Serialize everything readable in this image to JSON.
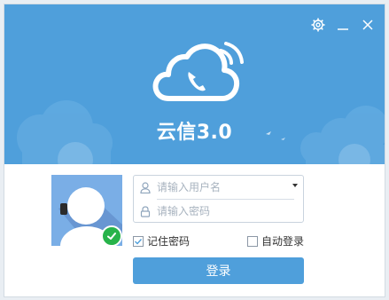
{
  "app": {
    "title": "云信3.0"
  },
  "controls": {
    "settings_icon": "gear-icon",
    "minimize_icon": "minimize-icon",
    "close_icon": "close-icon"
  },
  "form": {
    "username_placeholder": "请输入用户名",
    "password_placeholder": "请输入密码",
    "remember_password": {
      "label": "记住密码",
      "checked": true
    },
    "auto_login": {
      "label": "自动登录",
      "checked": false
    },
    "login_button": "登录"
  },
  "colors": {
    "accent": "#4f9fdb",
    "status_online": "#27b34a"
  }
}
